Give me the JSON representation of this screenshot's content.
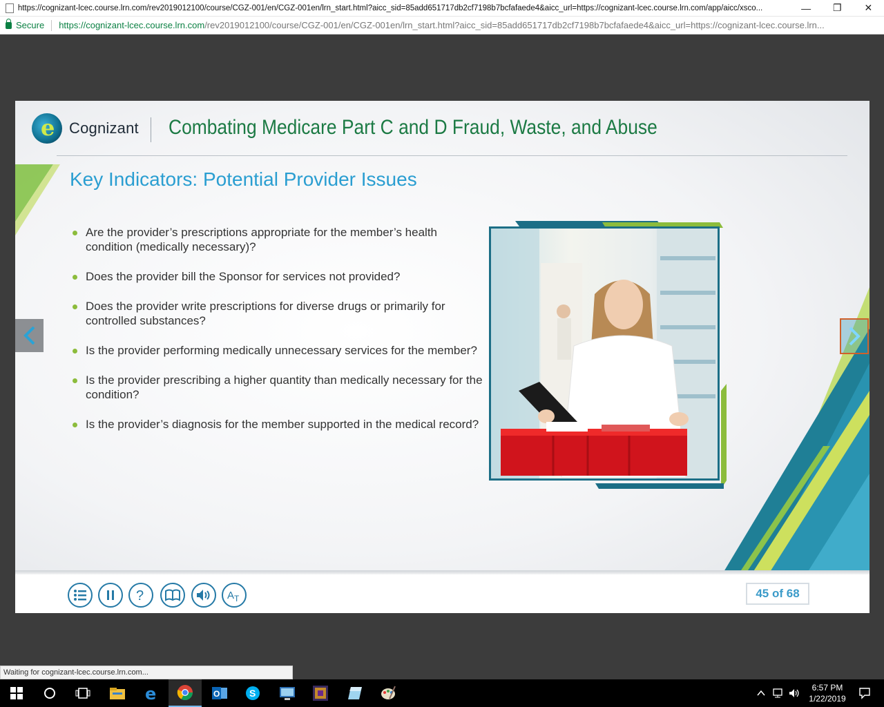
{
  "browser": {
    "window_title": "https://cognizant-lcec.course.lrn.com/rev2019012100/course/CGZ-001/en/CGZ-001en/lrn_start.html?aicc_sid=85add651717db2cf7198b7bcfafaede4&aicc_url=https://cognizant-lcec.course.lrn.com/app/aicc/xsco...",
    "minimize": "—",
    "restore": "❐",
    "close": "✕",
    "secure_label": "Secure",
    "url_host": "https://cognizant-lcec.course.lrn.com",
    "url_path": "/rev2019012100/course/CGZ-001/en/CGZ-001en/lrn_start.html?aicc_sid=85add651717db2cf7198b7bcfafaede4&aicc_url=https://cognizant-lcec.course.lrn...",
    "status_text": "Waiting for cognizant-lcec.course.lrn.com..."
  },
  "slide": {
    "brand": "Cognizant",
    "course_title": "Combating Medicare Part C and D Fraud, Waste, and Abuse",
    "title": "Key Indicators: Potential Provider Issues",
    "bullets": [
      "Are the provider’s prescriptions appropriate for the member’s health condition (medically necessary)?",
      "Does the provider bill the Sponsor for services not provided?",
      "Does the provider write prescriptions for diverse drugs or primarily for controlled substances?",
      "Is the provider performing medically unnecessary services for the member?",
      "Is the provider prescribing a higher quantity than medically necessary for the condition?",
      "Is the provider’s diagnosis for the member supported in the medical record?"
    ],
    "page_counter": "45 of 68",
    "colors": {
      "title_blue": "#2a9ed1",
      "course_green": "#1c7a44",
      "accent_green": "#8cbc3c",
      "accent_teal": "#1c6e86"
    },
    "toolbar": [
      {
        "icon": "menu-list-icon"
      },
      {
        "icon": "pause-icon"
      },
      {
        "icon": "help-icon"
      },
      {
        "icon": "glossary-book-icon"
      },
      {
        "icon": "audio-volume-icon"
      },
      {
        "icon": "text-size-icon"
      }
    ]
  },
  "taskbar": {
    "time": "6:57 PM",
    "date": "1/22/2019",
    "apps": [
      "start-icon",
      "task-view-circle-icon",
      "task-view-icon",
      "file-explorer-icon",
      "edge-icon",
      "chrome-icon",
      "outlook-icon",
      "skype-icon",
      "remote-desktop-icon",
      "game-icon",
      "app-icon",
      "paint-icon"
    ]
  }
}
